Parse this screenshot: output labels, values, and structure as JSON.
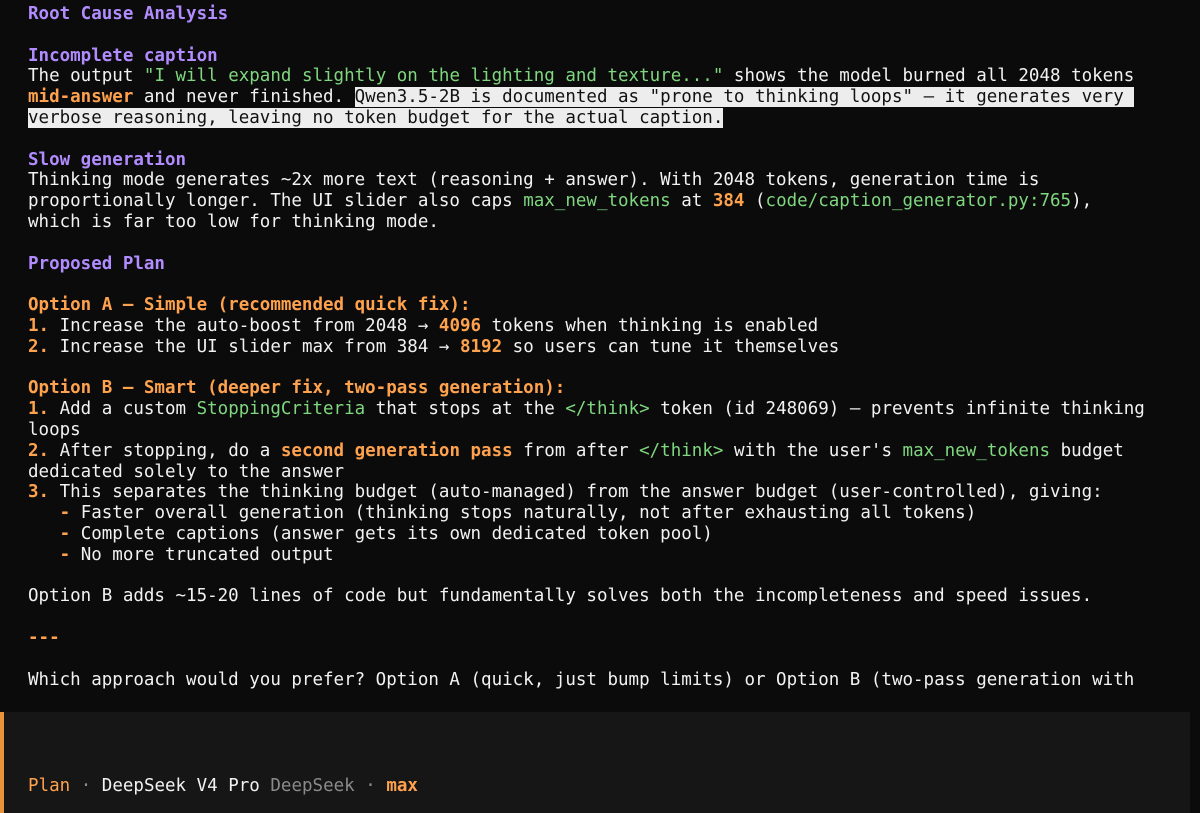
{
  "colors": {
    "background": "#0b0b0b",
    "text": "#f2f2f2",
    "heading": "#b18cff",
    "accent": "#ffa24d",
    "code": "#7fd77f",
    "muted": "#8a8a8a",
    "selection": "#ededed",
    "input_border": "#e8923a"
  },
  "lines": [
    [
      {
        "t": "Root Cause Analysis",
        "s": "h"
      }
    ],
    [],
    [
      {
        "t": "Incomplete caption",
        "s": "h"
      }
    ],
    [
      {
        "t": "The output "
      },
      {
        "t": "\"I will expand slightly on the lighting and texture...\"",
        "s": "g"
      },
      {
        "t": " shows the model burned all 2048 tokens"
      }
    ],
    [
      {
        "t": "mid-answer",
        "s": "o"
      },
      {
        "t": " and never finished. "
      },
      {
        "t": "Qwen3.5-2B is documented as \"prone to thinking loops\" – it generates very ",
        "s": "hl"
      }
    ],
    [
      {
        "t": "verbose reasoning, leaving no token budget for the actual caption.",
        "s": "hl"
      }
    ],
    [],
    [
      {
        "t": "Slow generation",
        "s": "h"
      }
    ],
    [
      {
        "t": "Thinking mode generates ~2x more text (reasoning + answer). With 2048 tokens, generation time is"
      }
    ],
    [
      {
        "t": "proportionally longer. The UI slider also caps "
      },
      {
        "t": "max_new_tokens",
        "s": "g"
      },
      {
        "t": " at "
      },
      {
        "t": "384",
        "s": "o"
      },
      {
        "t": " ("
      },
      {
        "t": "code/caption_generator.py:765",
        "s": "g"
      },
      {
        "t": "),"
      }
    ],
    [
      {
        "t": "which is far too low for thinking mode."
      }
    ],
    [],
    [
      {
        "t": "Proposed Plan",
        "s": "h"
      }
    ],
    [],
    [
      {
        "t": "Option A – Simple (recommended quick fix):",
        "s": "o"
      }
    ],
    [
      {
        "t": "1.",
        "s": "o"
      },
      {
        "t": " Increase the auto-boost from 2048 → "
      },
      {
        "t": "4096",
        "s": "o"
      },
      {
        "t": " tokens when thinking is enabled"
      }
    ],
    [
      {
        "t": "2.",
        "s": "o"
      },
      {
        "t": " Increase the UI slider max from 384 → "
      },
      {
        "t": "8192",
        "s": "o"
      },
      {
        "t": " so users can tune it themselves"
      }
    ],
    [],
    [
      {
        "t": "Option B – Smart (deeper fix, two-pass generation):",
        "s": "o"
      }
    ],
    [
      {
        "t": "1.",
        "s": "o"
      },
      {
        "t": " Add a custom "
      },
      {
        "t": "StoppingCriteria",
        "s": "g"
      },
      {
        "t": " that stops at the "
      },
      {
        "t": "</think>",
        "s": "g"
      },
      {
        "t": " token (id 248069) – prevents infinite thinking"
      }
    ],
    [
      {
        "t": "loops"
      }
    ],
    [
      {
        "t": "2.",
        "s": "o"
      },
      {
        "t": " After stopping, do a "
      },
      {
        "t": "second generation pass",
        "s": "o"
      },
      {
        "t": " from after "
      },
      {
        "t": "</think>",
        "s": "g"
      },
      {
        "t": " with the user's "
      },
      {
        "t": "max_new_tokens",
        "s": "g"
      },
      {
        "t": " budget"
      }
    ],
    [
      {
        "t": "dedicated solely to the answer"
      }
    ],
    [
      {
        "t": "3.",
        "s": "o"
      },
      {
        "t": " This separates the thinking budget (auto-managed) from the answer budget (user-controlled), giving:"
      }
    ],
    [
      {
        "t": "   "
      },
      {
        "t": "-",
        "s": "o"
      },
      {
        "t": " Faster overall generation (thinking stops naturally, not after exhausting all tokens)"
      }
    ],
    [
      {
        "t": "   "
      },
      {
        "t": "-",
        "s": "o"
      },
      {
        "t": " Complete captions (answer gets its own dedicated token pool)"
      }
    ],
    [
      {
        "t": "   "
      },
      {
        "t": "-",
        "s": "o"
      },
      {
        "t": " No more truncated output"
      }
    ],
    [],
    [
      {
        "t": "Option B adds ~15-20 lines of code but fundamentally solves both the incompleteness and speed issues."
      }
    ],
    [],
    [
      {
        "t": "---",
        "s": "o"
      }
    ],
    [],
    [
      {
        "t": "Which approach would you prefer? Option A (quick, just bump limits) or Option B (two-pass generation with"
      }
    ]
  ],
  "status_bar": {
    "mode": "Plan",
    "separator": "·",
    "model": "DeepSeek V4 Pro",
    "provider": "DeepSeek",
    "effort": "max"
  }
}
